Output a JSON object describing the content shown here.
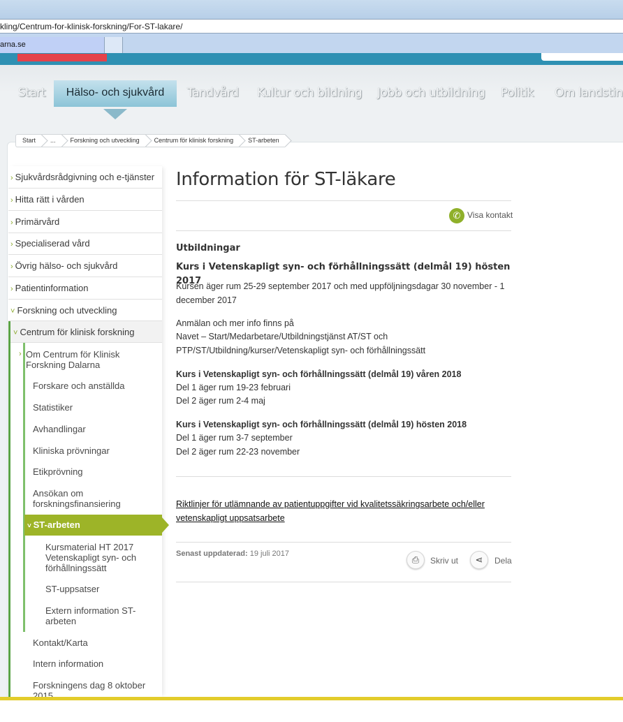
{
  "browser": {
    "url": "kling/Centrum-for-klinisk-forskning/For-ST-lakare/",
    "tab_title": "arna.se"
  },
  "nav": {
    "items": [
      "Start",
      "Hälso- och sjukvård",
      "Tandvård",
      "Kultur och bildning",
      "Jobb och utbildning",
      "Politik",
      "Om landsting"
    ],
    "active": "Hälso- och sjukvård"
  },
  "breadcrumb": [
    "Start",
    "...",
    "Forskning och utveckling",
    "Centrum för klinisk forskning",
    "ST-arbeten"
  ],
  "sidebar": {
    "items": [
      "Sjukvårdsrådgivning och e-tjänster",
      "Hitta rätt i vården",
      "Primärvård",
      "Specialiserad vård",
      "Övrig hälso- och sjukvård",
      "Patientinformation",
      "Forskning och utveckling"
    ],
    "centrum": "Centrum för klinisk forskning",
    "centrum_items": [
      "Om Centrum för Klinisk Forskning Dalarna",
      "Forskare och anställda",
      "Statistiker",
      "Avhandlingar",
      "Kliniska prövningar",
      "Etikprövning",
      "Ansökan om forskningsfinansiering"
    ],
    "active": "ST-arbeten",
    "st_items": [
      "Kursmaterial HT 2017 Vetenskapligt syn- och förhållningssätt",
      "ST-uppsatser",
      "Extern information ST-arbeten"
    ],
    "more_items": [
      "Kontakt/Karta",
      "Intern information",
      "Forskningens dag 8 oktober 2015"
    ]
  },
  "main": {
    "title": "Information för ST-läkare",
    "contact": "Visa kontakt",
    "h_utb": "Utbildningar",
    "h_kurs1": "Kurs i Vetenskapligt syn- och förhållningssätt (delmål 19) hösten 2017",
    "p1": "Kursen äger rum 25-29 september 2017 och med uppföljningsdagar 30 november - 1 december 2017",
    "p2a": "Anmälan och mer info finns på",
    "p2b": "Navet – Start/Medarbetare/Utbildningstjänst AT/ST och PTP/ST/Utbildning/kurser/Vetenskapligt syn- och förhållningssätt",
    "h_kurs2": "Kurs i Vetenskapligt syn- och förhållningssätt (delmål 19) våren 2018",
    "k2a": "Del 1 äger rum 19-23 februari",
    "k2b": "Del 2 äger rum 2-4 maj",
    "h_kurs3": "Kurs i Vetenskapligt syn- och förhållningssätt (delmål 19) hösten 2018",
    "k3a": "Del 1 äger rum 3-7 september",
    "k3b": "Del 2 äger rum 22-23 november",
    "link": "Riktlinjer för utlämnande av patientuppgifter vid kvalitetssäkringsarbete och/eller vetenskapligt uppsatsarbete",
    "updated_label": "Senast uppdaterad:",
    "updated_date": "19 juli 2017",
    "print": "Skriv ut",
    "share": "Dela"
  },
  "colors": {
    "accent_green": "#9db428",
    "header_teal": "#2e90b3",
    "footer_yellow": "#e3cc2b"
  }
}
